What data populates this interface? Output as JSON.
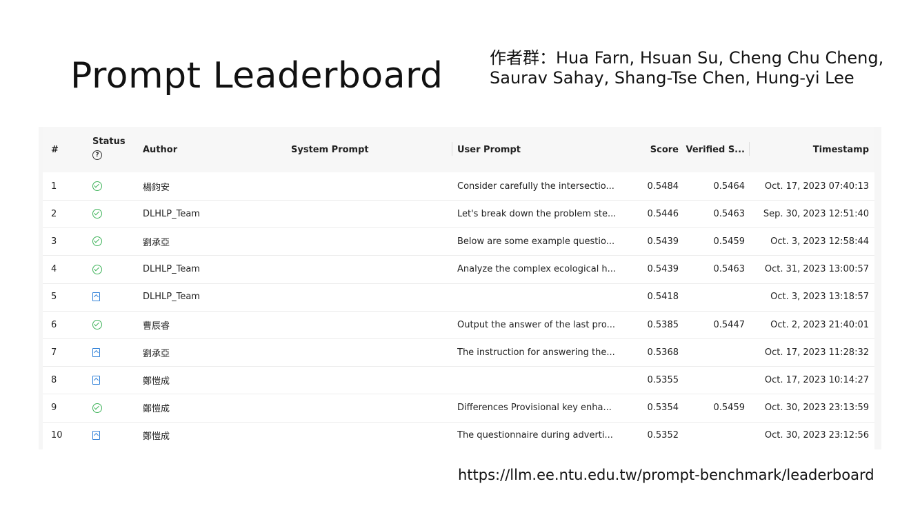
{
  "slide": {
    "title": "Prompt Leaderboard",
    "authors_line1": "作者群：Hua Farn, Hsuan Su, Cheng Chu Cheng,",
    "authors_line2": "Saurav Sahay, Shang-Tse Chen, Hung-yi Lee",
    "url": "https://llm.ee.ntu.edu.tw/prompt-benchmark/leaderboard"
  },
  "table": {
    "headers": {
      "num": "#",
      "status": "Status",
      "status_help": "?",
      "author": "Author",
      "system_prompt": "System Prompt",
      "user_prompt": "User Prompt",
      "score": "Score",
      "verified": "Verified S...",
      "timestamp": "Timestamp"
    },
    "rows": [
      {
        "num": "1",
        "status": "check-circle-icon",
        "author": "楊鈞安",
        "system_prompt": "",
        "user_prompt": "Consider carefully the intersectio...",
        "score": "0.5484",
        "verified": "0.5464",
        "timestamp": "Oct. 17, 2023 07:40:13"
      },
      {
        "num": "2",
        "status": "check-circle-icon",
        "author": "DLHLP_Team",
        "system_prompt": "",
        "user_prompt": "Let's break down the problem ste...",
        "score": "0.5446",
        "verified": "0.5463",
        "timestamp": "Sep. 30, 2023 12:51:40"
      },
      {
        "num": "3",
        "status": "check-circle-icon",
        "author": "劉承亞",
        "system_prompt": "",
        "user_prompt": "Below are some example questio...",
        "score": "0.5439",
        "verified": "0.5459",
        "timestamp": "Oct. 3, 2023 12:58:44"
      },
      {
        "num": "4",
        "status": "check-circle-icon",
        "author": "DLHLP_Team",
        "system_prompt": "",
        "user_prompt": "Analyze the complex ecological h...",
        "score": "0.5439",
        "verified": "0.5463",
        "timestamp": "Oct. 31, 2023 13:00:57"
      },
      {
        "num": "5",
        "status": "document-icon",
        "author": "DLHLP_Team",
        "system_prompt": "",
        "user_prompt": "",
        "score": "0.5418",
        "verified": "",
        "timestamp": "Oct. 3, 2023 13:18:57"
      },
      {
        "num": "6",
        "status": "check-circle-icon",
        "author": "曹辰睿",
        "system_prompt": "",
        "user_prompt": "Output the answer of the last pro...",
        "score": "0.5385",
        "verified": "0.5447",
        "timestamp": "Oct. 2, 2023 21:40:01"
      },
      {
        "num": "7",
        "status": "document-icon",
        "author": "劉承亞",
        "system_prompt": "",
        "user_prompt": "The instruction for answering the...",
        "score": "0.5368",
        "verified": "",
        "timestamp": "Oct. 17, 2023 11:28:32"
      },
      {
        "num": "8",
        "status": "document-icon",
        "author": "鄭愷成",
        "system_prompt": "",
        "user_prompt": "",
        "score": "0.5355",
        "verified": "",
        "timestamp": "Oct. 17, 2023 10:14:27"
      },
      {
        "num": "9",
        "status": "check-circle-icon",
        "author": "鄭愷成",
        "system_prompt": "",
        "user_prompt": "Differences Provisional key enha...",
        "score": "0.5354",
        "verified": "0.5459",
        "timestamp": "Oct. 30, 2023 23:13:59"
      },
      {
        "num": "10",
        "status": "document-icon",
        "author": "鄭愷成",
        "system_prompt": "",
        "user_prompt": "The questionnaire during adverti...",
        "score": "0.5352",
        "verified": "",
        "timestamp": "Oct. 30, 2023 23:12:56"
      }
    ]
  },
  "colors": {
    "check": "#3fb35a",
    "document": "#2f80d8"
  }
}
